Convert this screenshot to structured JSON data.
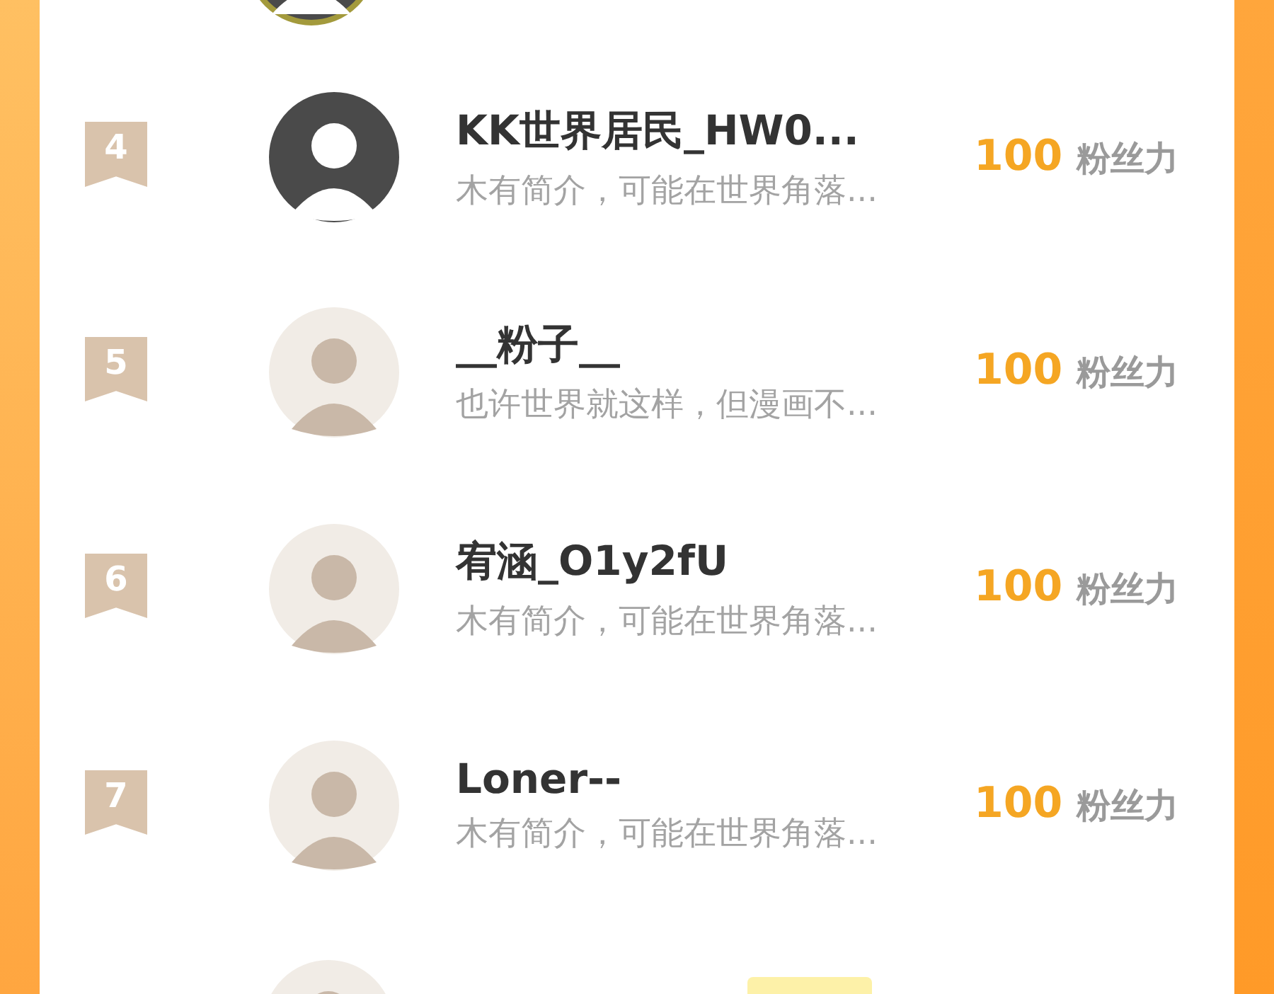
{
  "top_row": {
    "avatar": {
      "kind": "ringed"
    }
  },
  "rows": [
    {
      "rank": "4",
      "name": "KK世界居民_HW0...",
      "bio": "木有简介，可能在世界角落...",
      "score": "100",
      "unit": "粉丝力",
      "avatar": {
        "kind": "dark"
      }
    },
    {
      "rank": "5",
      "name": "__粉子__",
      "bio": "也许世界就这样，但漫画不...",
      "score": "100",
      "unit": "粉丝力",
      "avatar": {
        "kind": "light"
      }
    },
    {
      "rank": "6",
      "name": "宥涵_O1y2fU",
      "bio": "木有简介，可能在世界角落...",
      "score": "100",
      "unit": "粉丝力",
      "avatar": {
        "kind": "light"
      }
    },
    {
      "rank": "7",
      "name": "Loner--",
      "bio": "木有简介，可能在世界角落...",
      "score": "100",
      "unit": "粉丝力",
      "avatar": {
        "kind": "light"
      }
    }
  ],
  "bottom_row": {
    "avatar": {
      "kind": "light"
    },
    "badge": true
  }
}
